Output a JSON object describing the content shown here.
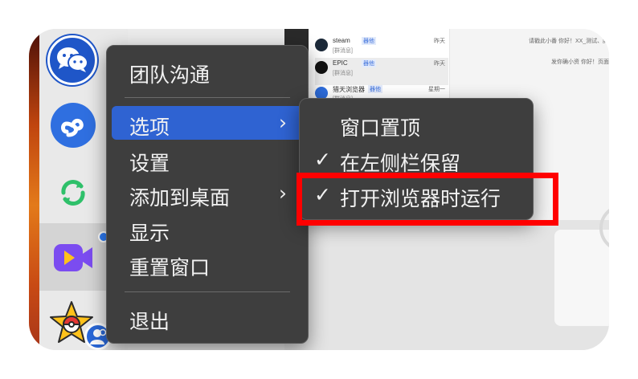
{
  "colors": {
    "menu_bg": "#3e3e3e",
    "highlight": "#2f63d2",
    "annotation": "#ff0000"
  },
  "dock": {
    "icons": [
      "wechat-icon",
      "mini-program-icon",
      "sync-icon",
      "meeting-icon",
      "pokeball-star-icon",
      "user-badge-icon"
    ]
  },
  "main_menu": {
    "items": [
      {
        "label": "团队沟通"
      },
      {
        "label": "选项",
        "has_submenu": true,
        "highlighted": true
      },
      {
        "label": "设置"
      },
      {
        "label": "添加到桌面",
        "has_submenu": true
      },
      {
        "label": "显示"
      },
      {
        "label": "重置窗口"
      },
      {
        "label": "退出"
      }
    ],
    "arrow": "›"
  },
  "submenu": {
    "items": [
      {
        "label": "窗口置顶",
        "checked": false
      },
      {
        "label": "在左侧栏保留",
        "checked": true
      },
      {
        "label": "打开浏览器时运行",
        "checked": true
      }
    ],
    "check_glyph": "✓"
  },
  "background_window": {
    "rows": [
      {
        "name": "steam",
        "tag": "器他",
        "sub": "[群消息]",
        "time": "昨天"
      },
      {
        "name": "EPIC",
        "tag": "器他",
        "sub": "[群消息]",
        "time": "昨天"
      },
      {
        "name": "猎天浏览器",
        "tag": "器他",
        "sub": "[群消息]",
        "time": "星期一"
      }
    ],
    "notes": [
      "请戳此小番 你好！XX_测试、腾天资讯",
      "发你确小资 你好！页面前不"
    ]
  }
}
